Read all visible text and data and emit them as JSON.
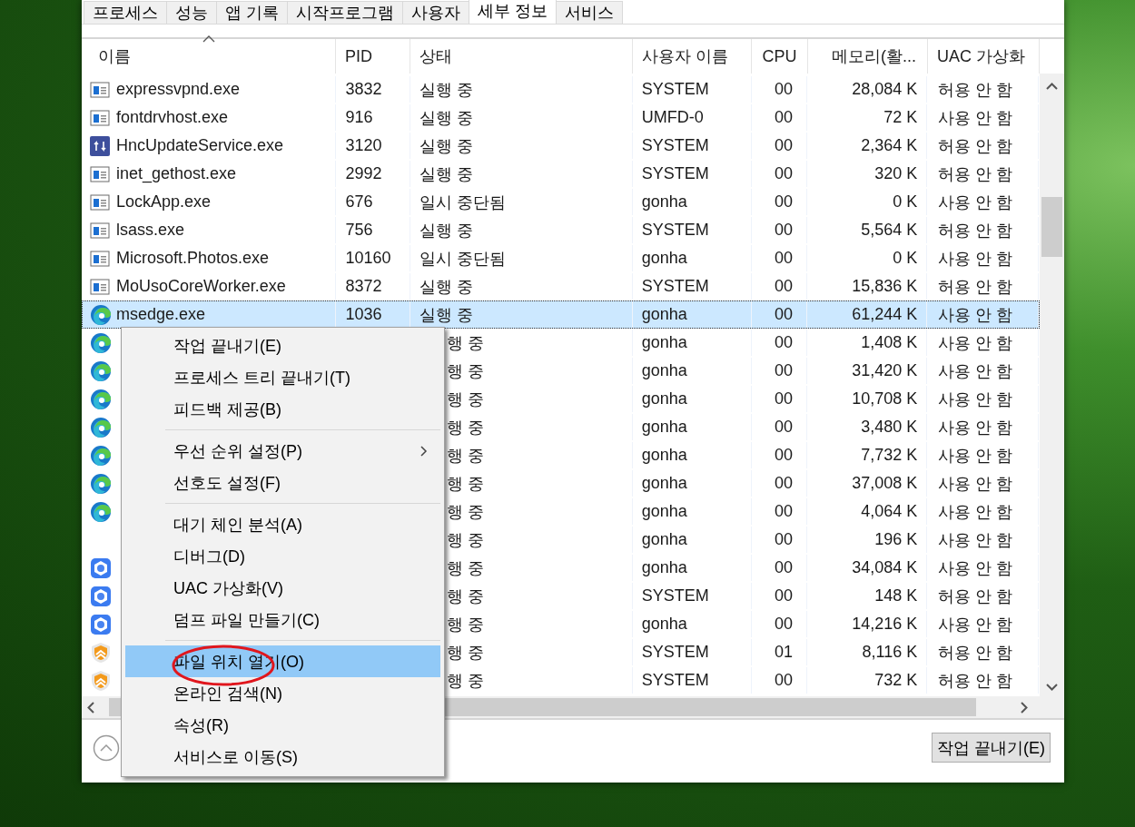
{
  "tabs": [
    {
      "label": "프로세스",
      "selected": false
    },
    {
      "label": "성능",
      "selected": false
    },
    {
      "label": "앱 기록",
      "selected": false
    },
    {
      "label": "시작프로그램",
      "selected": false
    },
    {
      "label": "사용자",
      "selected": false
    },
    {
      "label": "세부 정보",
      "selected": true
    },
    {
      "label": "서비스",
      "selected": false
    }
  ],
  "table": {
    "columns": [
      "이름",
      "PID",
      "상태",
      "사용자 이름",
      "CPU",
      "메모리(활...",
      "UAC 가상화"
    ],
    "rows": [
      {
        "kind": "app",
        "name": "expressvpnd.exe",
        "pid": "3832",
        "status": "실행 중",
        "user": "SYSTEM",
        "cpu": "00",
        "memory": "28,084 K",
        "uac": "허용 안 함",
        "selected": false
      },
      {
        "kind": "app",
        "name": "fontdrvhost.exe",
        "pid": "916",
        "status": "실행 중",
        "user": "UMFD-0",
        "cpu": "00",
        "memory": "72 K",
        "uac": "사용 안 함",
        "selected": false
      },
      {
        "kind": "updater",
        "name": "HncUpdateService.exe",
        "pid": "3120",
        "status": "실행 중",
        "user": "SYSTEM",
        "cpu": "00",
        "memory": "2,364 K",
        "uac": "허용 안 함",
        "selected": false
      },
      {
        "kind": "app",
        "name": "inet_gethost.exe",
        "pid": "2992",
        "status": "실행 중",
        "user": "SYSTEM",
        "cpu": "00",
        "memory": "320 K",
        "uac": "허용 안 함",
        "selected": false
      },
      {
        "kind": "app",
        "name": "LockApp.exe",
        "pid": "676",
        "status": "일시 중단됨",
        "user": "gonha",
        "cpu": "00",
        "memory": "0 K",
        "uac": "사용 안 함",
        "selected": false
      },
      {
        "kind": "app",
        "name": "lsass.exe",
        "pid": "756",
        "status": "실행 중",
        "user": "SYSTEM",
        "cpu": "00",
        "memory": "5,564 K",
        "uac": "허용 안 함",
        "selected": false
      },
      {
        "kind": "app",
        "name": "Microsoft.Photos.exe",
        "pid": "10160",
        "status": "일시 중단됨",
        "user": "gonha",
        "cpu": "00",
        "memory": "0 K",
        "uac": "사용 안 함",
        "selected": false
      },
      {
        "kind": "app",
        "name": "MoUsoCoreWorker.exe",
        "pid": "8372",
        "status": "실행 중",
        "user": "SYSTEM",
        "cpu": "00",
        "memory": "15,836 K",
        "uac": "허용 안 함",
        "selected": false
      },
      {
        "kind": "browser",
        "name": "msedge.exe",
        "pid": "1036",
        "status": "실행 중",
        "user": "gonha",
        "cpu": "00",
        "memory": "61,244 K",
        "uac": "사용 안 함",
        "selected": true
      },
      {
        "kind": "browser",
        "status": "행 중",
        "user": "gonha",
        "cpu": "00",
        "memory": "1,408 K",
        "uac": "사용 안 함",
        "selected": false
      },
      {
        "kind": "browser",
        "status": "행 중",
        "user": "gonha",
        "cpu": "00",
        "memory": "31,420 K",
        "uac": "사용 안 함",
        "selected": false
      },
      {
        "kind": "browser",
        "status": "행 중",
        "user": "gonha",
        "cpu": "00",
        "memory": "10,708 K",
        "uac": "사용 안 함",
        "selected": false
      },
      {
        "kind": "browser",
        "status": "행 중",
        "user": "gonha",
        "cpu": "00",
        "memory": "3,480 K",
        "uac": "사용 안 함",
        "selected": false
      },
      {
        "kind": "browser",
        "status": "행 중",
        "user": "gonha",
        "cpu": "00",
        "memory": "7,732 K",
        "uac": "사용 안 함",
        "selected": false
      },
      {
        "kind": "browser",
        "status": "행 중",
        "user": "gonha",
        "cpu": "00",
        "memory": "37,008 K",
        "uac": "사용 안 함",
        "selected": false
      },
      {
        "kind": "browser",
        "status": "행 중",
        "user": "gonha",
        "cpu": "00",
        "memory": "4,064 K",
        "uac": "사용 안 함",
        "selected": false
      },
      {
        "kind": "plain",
        "status": "행 중",
        "user": "gonha",
        "cpu": "00",
        "memory": "196 K",
        "uac": "사용 안 함",
        "selected": false
      },
      {
        "kind": "hexagon",
        "status": "행 중",
        "user": "gonha",
        "cpu": "00",
        "memory": "34,084 K",
        "uac": "사용 안 함",
        "selected": false
      },
      {
        "kind": "hexagon",
        "status": "행 중",
        "user": "SYSTEM",
        "cpu": "00",
        "memory": "148 K",
        "uac": "허용 안 함",
        "selected": false
      },
      {
        "kind": "hexagon",
        "status": "행 중",
        "user": "gonha",
        "cpu": "00",
        "memory": "14,216 K",
        "uac": "사용 안 함",
        "selected": false
      },
      {
        "kind": "shield",
        "status": "행 중",
        "user": "SYSTEM",
        "cpu": "01",
        "memory": "8,116 K",
        "uac": "허용 안 함",
        "selected": false
      },
      {
        "kind": "shield",
        "status": "행 중",
        "user": "SYSTEM",
        "cpu": "00",
        "memory": "732 K",
        "uac": "허용 안 함",
        "selected": false
      }
    ]
  },
  "context_menu": {
    "groups": [
      [
        {
          "label": "작업 끝내기(E)",
          "selected": false,
          "submenu": false
        },
        {
          "label": "프로세스 트리 끝내기(T)",
          "selected": false,
          "submenu": false
        },
        {
          "label": "피드백 제공(B)",
          "selected": false,
          "submenu": false
        }
      ],
      [
        {
          "label": "우선 순위 설정(P)",
          "selected": false,
          "submenu": true
        },
        {
          "label": "선호도 설정(F)",
          "selected": false,
          "submenu": false
        }
      ],
      [
        {
          "label": "대기 체인 분석(A)",
          "selected": false,
          "submenu": false
        },
        {
          "label": "디버그(D)",
          "selected": false,
          "submenu": false
        },
        {
          "label": "UAC 가상화(V)",
          "selected": false,
          "submenu": false
        },
        {
          "label": "덤프 파일 만들기(C)",
          "selected": false,
          "submenu": false
        }
      ],
      [
        {
          "label": "파일 위치 열기(O)",
          "selected": true,
          "submenu": false
        },
        {
          "label": "온라인 검색(N)",
          "selected": false,
          "submenu": false
        },
        {
          "label": "속성(R)",
          "selected": false,
          "submenu": false
        },
        {
          "label": "서비스로 이동(S)",
          "selected": false,
          "submenu": false
        }
      ]
    ]
  },
  "end_task_button": "작업 끝내기(E)"
}
